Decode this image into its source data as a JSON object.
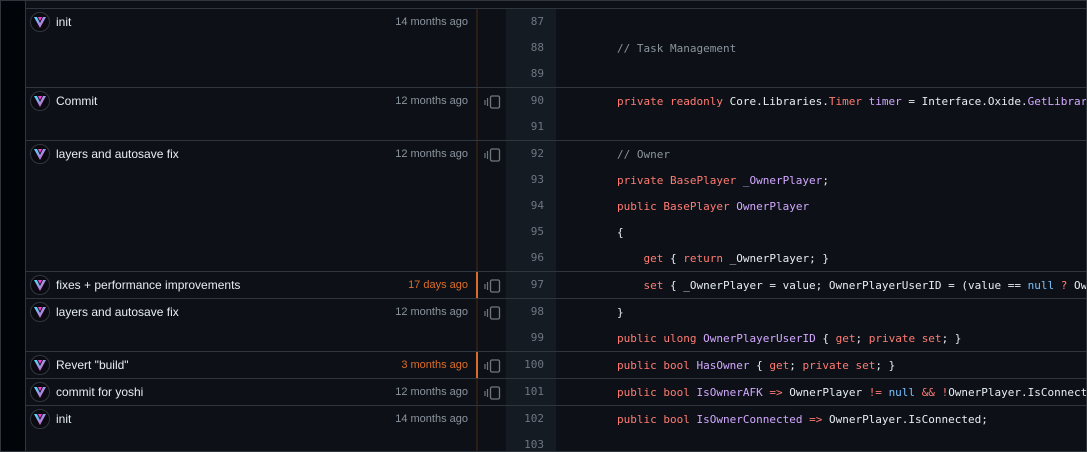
{
  "groups": [
    {
      "message": "init",
      "age": "14 months ago",
      "recent": false,
      "reblame": false,
      "lines": [
        {
          "n": "87",
          "tokens": []
        },
        {
          "n": "88",
          "tokens": [
            [
              "        ",
              ""
            ],
            [
              "// Task Management",
              "c"
            ]
          ]
        },
        {
          "n": "89",
          "tokens": []
        }
      ]
    },
    {
      "message": "Commit",
      "age": "12 months ago",
      "recent": false,
      "reblame": true,
      "lines": [
        {
          "n": "90",
          "tokens": [
            [
              "        ",
              ""
            ],
            [
              "private",
              "k"
            ],
            [
              " ",
              ""
            ],
            [
              "readonly",
              "k"
            ],
            [
              " Core.Libraries.",
              ""
            ],
            [
              "Timer",
              "k"
            ],
            [
              " ",
              ""
            ],
            [
              "timer",
              "f"
            ],
            [
              " = Interface.Oxide.",
              ""
            ],
            [
              "GetLibrary",
              "f"
            ]
          ]
        },
        {
          "n": "91",
          "tokens": []
        }
      ]
    },
    {
      "message": "layers and autosave fix",
      "age": "12 months ago",
      "recent": false,
      "reblame": true,
      "lines": [
        {
          "n": "92",
          "tokens": [
            [
              "        ",
              ""
            ],
            [
              "// Owner",
              "c"
            ]
          ]
        },
        {
          "n": "93",
          "tokens": [
            [
              "        ",
              ""
            ],
            [
              "private",
              "k"
            ],
            [
              " ",
              ""
            ],
            [
              "BasePlayer",
              "k"
            ],
            [
              " ",
              ""
            ],
            [
              "_OwnerPlayer",
              "f"
            ],
            [
              ";",
              ""
            ]
          ]
        },
        {
          "n": "94",
          "tokens": [
            [
              "        ",
              ""
            ],
            [
              "public",
              "k"
            ],
            [
              " ",
              ""
            ],
            [
              "BasePlayer",
              "k"
            ],
            [
              " ",
              ""
            ],
            [
              "OwnerPlayer",
              "f"
            ]
          ]
        },
        {
          "n": "95",
          "tokens": [
            [
              "        {",
              ""
            ]
          ]
        },
        {
          "n": "96",
          "tokens": [
            [
              "            ",
              ""
            ],
            [
              "get",
              "k"
            ],
            [
              " { ",
              ""
            ],
            [
              "return",
              "k"
            ],
            [
              " _OwnerPlayer; }",
              ""
            ]
          ]
        }
      ]
    },
    {
      "message": "fixes + performance improvements",
      "age": "17 days ago",
      "recent": true,
      "reblame": true,
      "lines": [
        {
          "n": "97",
          "tokens": [
            [
              "            ",
              ""
            ],
            [
              "set",
              "k"
            ],
            [
              " { _OwnerPlayer = value; OwnerPlayerUserID = (value == ",
              ""
            ],
            [
              "null",
              "n"
            ],
            [
              " ",
              ""
            ],
            [
              "?",
              "k"
            ],
            [
              " OwnerPlayer.UserIDString",
              ""
            ]
          ]
        }
      ]
    },
    {
      "message": "layers and autosave fix",
      "age": "12 months ago",
      "recent": false,
      "reblame": true,
      "lines": [
        {
          "n": "98",
          "tokens": [
            [
              "        }",
              ""
            ]
          ]
        },
        {
          "n": "99",
          "tokens": [
            [
              "        ",
              ""
            ],
            [
              "public",
              "k"
            ],
            [
              " ",
              ""
            ],
            [
              "ulong",
              "k"
            ],
            [
              " ",
              ""
            ],
            [
              "OwnerPlayerUserID",
              "f"
            ],
            [
              " { ",
              ""
            ],
            [
              "get",
              "k"
            ],
            [
              "; ",
              ""
            ],
            [
              "private",
              "k"
            ],
            [
              " ",
              ""
            ],
            [
              "set",
              "k"
            ],
            [
              "; }",
              ""
            ]
          ]
        }
      ]
    },
    {
      "message": "Revert \"build\"",
      "age": "3 months ago",
      "recent": true,
      "reblame": true,
      "lines": [
        {
          "n": "100",
          "tokens": [
            [
              "        ",
              ""
            ],
            [
              "public",
              "k"
            ],
            [
              " ",
              ""
            ],
            [
              "bool",
              "k"
            ],
            [
              " ",
              ""
            ],
            [
              "HasOwner",
              "f"
            ],
            [
              " { ",
              ""
            ],
            [
              "get",
              "k"
            ],
            [
              "; ",
              ""
            ],
            [
              "private",
              "k"
            ],
            [
              " ",
              ""
            ],
            [
              "set",
              "k"
            ],
            [
              "; }",
              ""
            ]
          ]
        }
      ]
    },
    {
      "message": "commit for yoshi",
      "age": "12 months ago",
      "recent": false,
      "reblame": true,
      "lines": [
        {
          "n": "101",
          "tokens": [
            [
              "        ",
              ""
            ],
            [
              "public",
              "k"
            ],
            [
              " ",
              ""
            ],
            [
              "bool",
              "k"
            ],
            [
              " ",
              ""
            ],
            [
              "IsOwnerAFK",
              "f"
            ],
            [
              " ",
              ""
            ],
            [
              "=>",
              "k"
            ],
            [
              " OwnerPlayer ",
              ""
            ],
            [
              "!=",
              "k"
            ],
            [
              " ",
              ""
            ],
            [
              "null",
              "n"
            ],
            [
              " ",
              ""
            ],
            [
              "&&",
              "k"
            ],
            [
              " ",
              ""
            ],
            [
              "!",
              "k"
            ],
            [
              "OwnerPlayer.IsConnected;",
              ""
            ]
          ]
        }
      ]
    },
    {
      "message": "init",
      "age": "14 months ago",
      "recent": false,
      "reblame": false,
      "lines": [
        {
          "n": "102",
          "tokens": [
            [
              "        ",
              ""
            ],
            [
              "public",
              "k"
            ],
            [
              " ",
              ""
            ],
            [
              "bool",
              "k"
            ],
            [
              " ",
              ""
            ],
            [
              "IsOwnerConnected",
              "f"
            ],
            [
              " ",
              ""
            ],
            [
              "=>",
              "k"
            ],
            [
              " OwnerPlayer.IsConnected;",
              ""
            ]
          ]
        },
        {
          "n": "103",
          "tokens": []
        }
      ]
    }
  ]
}
